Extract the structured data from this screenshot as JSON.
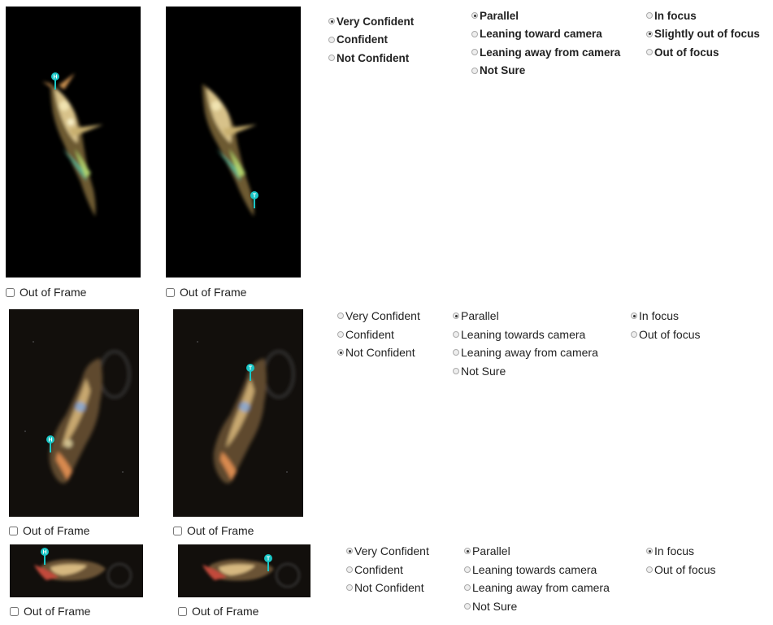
{
  "rows": [
    {
      "out_of_frame_label": "Out of Frame",
      "markers": [
        "H",
        "T"
      ],
      "confidence": {
        "options": [
          "Very Confident",
          "Confident",
          "Not Confident"
        ],
        "selected": 0
      },
      "orientation": {
        "options": [
          "Parallel",
          "Leaning toward camera",
          "Leaning away from camera",
          "Not Sure"
        ],
        "selected": 0
      },
      "focus": {
        "options": [
          "In focus",
          "Slightly out of focus",
          "Out of focus"
        ],
        "selected": 1
      }
    },
    {
      "out_of_frame_label": "Out of Frame",
      "markers": [
        "H",
        "T"
      ],
      "confidence": {
        "options": [
          "Very Confident",
          "Confident",
          "Not Confident"
        ],
        "selected": 2
      },
      "orientation": {
        "options": [
          "Parallel",
          "Leaning towards camera",
          "Leaning away from camera",
          "Not Sure"
        ],
        "selected": 0
      },
      "focus": {
        "options": [
          "In focus",
          "Out of focus"
        ],
        "selected": 0
      }
    },
    {
      "out_of_frame_label": "Out of Frame",
      "markers": [
        "H",
        "T"
      ],
      "confidence": {
        "options": [
          "Very Confident",
          "Confident",
          "Not Confident"
        ],
        "selected": 0
      },
      "orientation": {
        "options": [
          "Parallel",
          "Leaning towards camera",
          "Leaning away from camera",
          "Not Sure"
        ],
        "selected": 0
      },
      "focus": {
        "options": [
          "In focus",
          "Out of focus"
        ],
        "selected": 0
      }
    }
  ],
  "colors": {
    "marker": "#19c6c6",
    "image_bg": "#000000"
  }
}
